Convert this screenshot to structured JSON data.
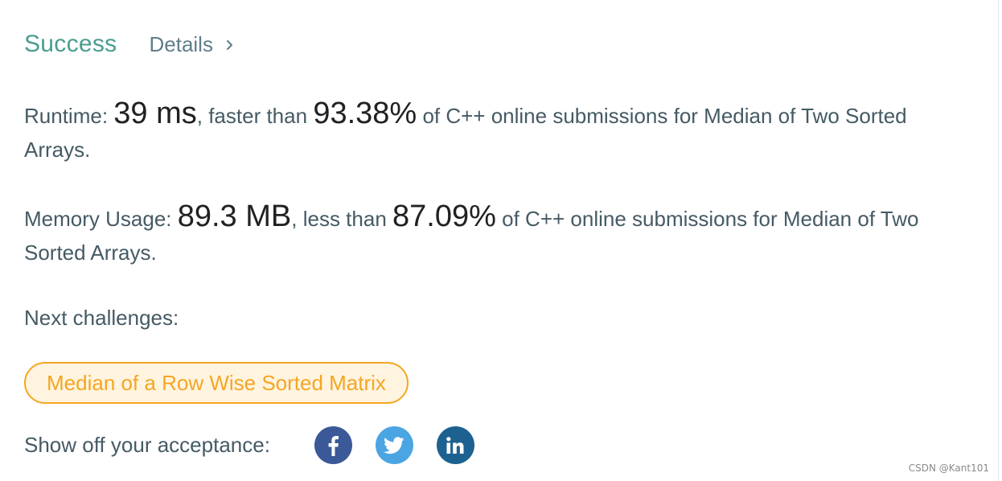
{
  "header": {
    "status": "Success",
    "details_label": "Details"
  },
  "runtime": {
    "label": "Runtime:",
    "value": "39 ms",
    "comparison": ", faster than",
    "percent": "93.38%",
    "suffix": "of C++ online submissions for Median of Two Sorted Arrays."
  },
  "memory": {
    "label": "Memory Usage:",
    "value": "89.3 MB",
    "comparison": ", less than",
    "percent": "87.09%",
    "suffix": "of C++ online submissions for Median of Two Sorted Arrays."
  },
  "next": {
    "label": "Next challenges:",
    "challenges": [
      "Median of a Row Wise Sorted Matrix"
    ]
  },
  "share": {
    "label": "Show off your acceptance:",
    "icons": [
      "facebook-icon",
      "twitter-icon",
      "linkedin-icon"
    ]
  },
  "colors": {
    "success": "#4a9d8f",
    "challenge": "#f5a623",
    "facebook": "#3b5998",
    "twitter": "#4ba5e3",
    "linkedin": "#1d6190"
  },
  "watermark": "CSDN @Kant101"
}
